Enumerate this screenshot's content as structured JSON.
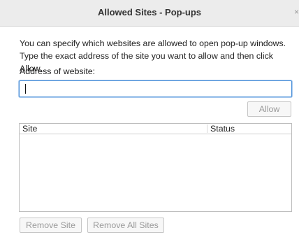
{
  "window": {
    "title": "Allowed Sites - Pop-ups",
    "close_glyph": "×"
  },
  "description": "You can specify which websites are allowed to open pop-up windows. Type the exact address of the site you want to allow and then click Allow.",
  "address": {
    "label": "Address of website:",
    "value": "",
    "placeholder": ""
  },
  "buttons": {
    "allow": "Allow",
    "remove_site": "Remove Site",
    "remove_all_sites": "Remove All Sites"
  },
  "table": {
    "columns": [
      "Site",
      "Status"
    ],
    "rows": []
  },
  "colors": {
    "focus_border": "#4a90d9",
    "disabled_text": "#9a9a9a",
    "titlebar_bg": "#ececec"
  }
}
